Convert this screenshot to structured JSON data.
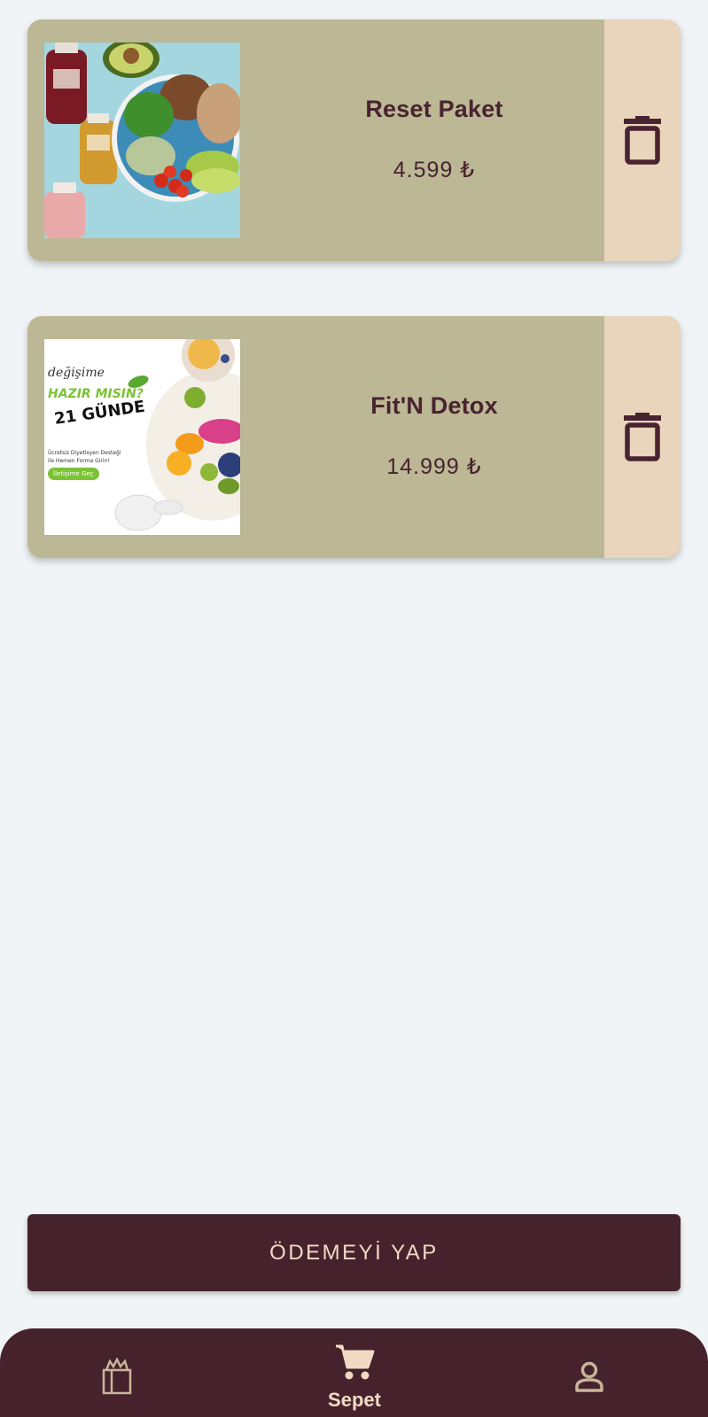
{
  "cart": {
    "items": [
      {
        "image": "reset-paket-image",
        "title": "Reset Paket",
        "price": "4.599 ₺"
      },
      {
        "image": "fitn-detox-image",
        "title": "Fit'N Detox",
        "price": "14.999 ₺"
      }
    ]
  },
  "promo_image": {
    "script_word": "değişime",
    "headline": "HAZIR MISIN?",
    "days": "21 GÜNDE",
    "line1": "Ücretsiz Diyetisyen Desteği",
    "line2": "ile Hemen Forma Girin!",
    "button": "İletişime Geç"
  },
  "checkout": {
    "label": "ÖDEMEYİ YAP"
  },
  "bottom_nav": {
    "items": [
      {
        "icon": "shopping-bag-icon",
        "label": ""
      },
      {
        "icon": "cart-icon",
        "label": "Sepet"
      },
      {
        "icon": "user-icon",
        "label": ""
      }
    ]
  },
  "colors": {
    "background": "#f0f4f6",
    "card": "#bcb794",
    "delete_panel": "#e8d5bc",
    "primary": "#46222d",
    "accent_text": "#f1dac4"
  }
}
